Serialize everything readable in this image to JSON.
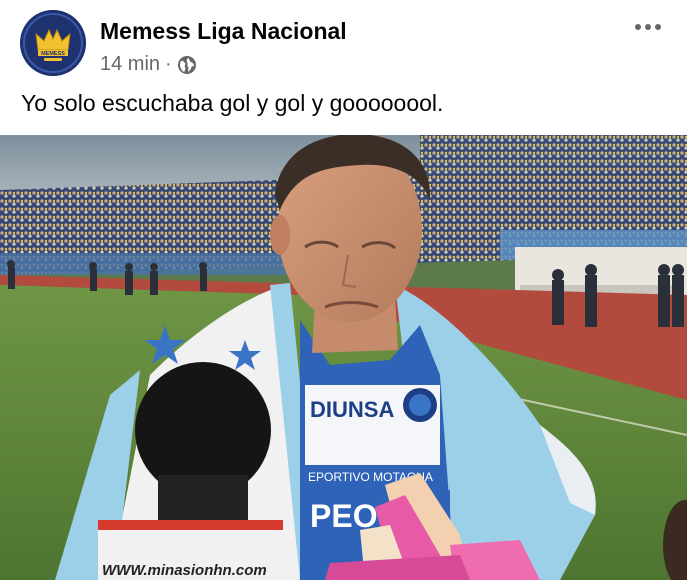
{
  "post": {
    "page_name": "Memess Liga Nacional",
    "timestamp": "14 min",
    "separator": "·",
    "privacy_icon": "globe-icon",
    "more_icon": "more-options-icon",
    "caption": "Yo solo escuchaba gol y gol y goooooool.",
    "avatar": {
      "text": "MEMESS",
      "colors": {
        "background": "#1f3270",
        "crest": "#f2c230"
      }
    }
  },
  "photo": {
    "jersey_sponsor": "DIUNSA",
    "jersey_club_text": "EPORTIVO MOTAGUA",
    "jersey_bottom_text": "PEO",
    "mic_label": "WWW.minasionhn.com",
    "colors": {
      "jersey_blue": "#2f63b8",
      "flag_blue": "#9ccfe8",
      "pitch_green": "#5f8a3d",
      "track_red": "#b24a3e",
      "sky": "#8a9aa6"
    }
  }
}
